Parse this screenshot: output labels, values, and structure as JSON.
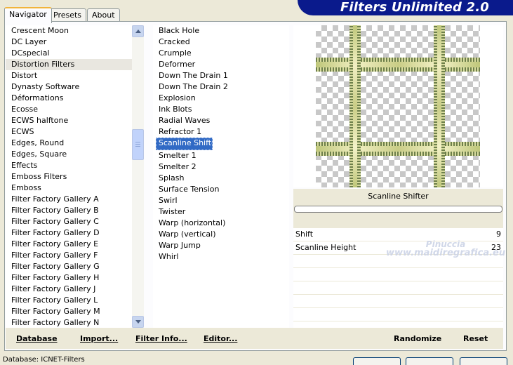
{
  "app": {
    "title": "Filters Unlimited 2.0"
  },
  "tabs": [
    {
      "label": "Navigator"
    },
    {
      "label": "Presets"
    },
    {
      "label": "About"
    }
  ],
  "categories": {
    "selected": "Distortion Filters",
    "items": [
      "Crescent Moon",
      "DC Layer",
      "DCspecial",
      "Distortion Filters",
      "Distort",
      "Dynasty Software",
      "Déformations",
      "Ecosse",
      "ECWS halftone",
      "ECWS",
      "Edges, Round",
      "Edges, Square",
      "Effects",
      "Emboss Filters",
      "Emboss",
      "Filter Factory Gallery A",
      "Filter Factory Gallery B",
      "Filter Factory Gallery C",
      "Filter Factory Gallery D",
      "Filter Factory Gallery E",
      "Filter Factory Gallery F",
      "Filter Factory Gallery G",
      "Filter Factory Gallery H",
      "Filter Factory Gallery J",
      "Filter Factory Gallery L",
      "Filter Factory Gallery M",
      "Filter Factory Gallery N"
    ]
  },
  "filters": {
    "selected": "Scanline Shifter",
    "items": [
      "Black Hole",
      "Cracked",
      "Crumple",
      "Deformer",
      "Down The Drain 1",
      "Down The Drain 2",
      "Explosion",
      "Ink Blots",
      "Radial Waves",
      "Refractor 1",
      "Scanline Shifter",
      "Smelter 1",
      "Smelter 2",
      "Splash",
      "Surface Tension",
      "Swirl",
      "Twister",
      "Warp (horizontal)",
      "Warp (vertical)",
      "Warp Jump",
      "Whirl"
    ]
  },
  "preview": {
    "filter_name": "Scanline Shifter",
    "progress": 0
  },
  "params": [
    {
      "label": "Shift",
      "value": "9"
    },
    {
      "label": "Scanline Height",
      "value": "23"
    }
  ],
  "watermark": {
    "line1": "Pinuccia",
    "line2": "www.maidiregrafica.eu"
  },
  "bottom_left": {
    "database": "Database",
    "import": "Import...",
    "filter_info": "Filter Info...",
    "editor": "Editor..."
  },
  "bottom_right": {
    "randomize": "Randomize",
    "reset": "Reset"
  },
  "status": {
    "text": "Database: ICNET-Filters"
  },
  "colors": {
    "banner": "#0a1a8c",
    "selection": "#316ac5",
    "dialog_bg": "#ece9d8"
  }
}
